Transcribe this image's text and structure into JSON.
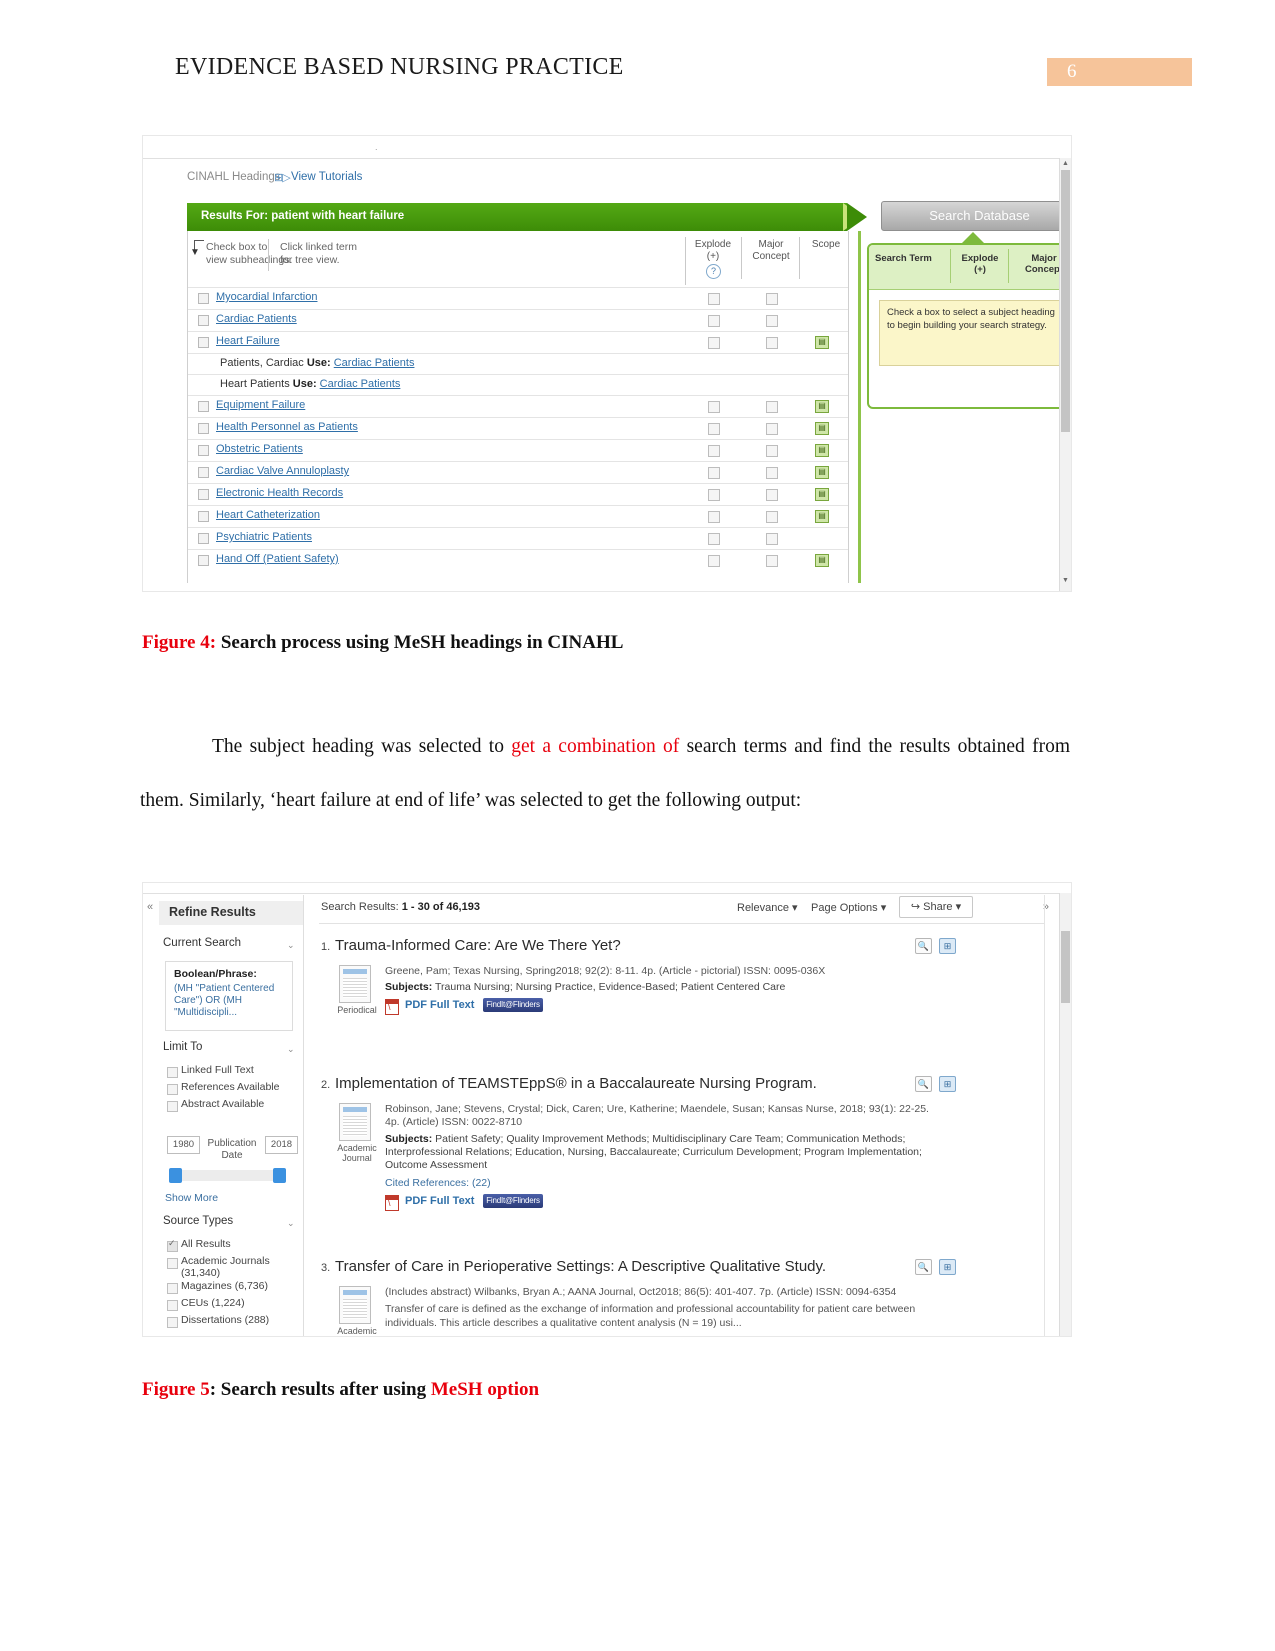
{
  "header": {
    "title": "EVIDENCE BASED NURSING PRACTICE",
    "page_number": "6",
    "accent_color": "#f6c49a"
  },
  "figure4": {
    "breadcrumb": "CINAHL Headings",
    "tutorials_link": "View Tutorials",
    "results_bar": "Results For: patient with heart failure",
    "hint_left": "Check box to\nview subheadings.",
    "hint_right": "Click linked term\nfor tree view.",
    "columns": {
      "explode": "Explode\n(+)",
      "major": "Major\nConcept",
      "scope": "Scope",
      "help": "?"
    },
    "rows": [
      {
        "term": "Myocardial Infarction",
        "type": "heading",
        "scope": false
      },
      {
        "term": "Cardiac Patients",
        "type": "heading",
        "scope": false
      },
      {
        "term": "Heart Failure",
        "type": "heading",
        "scope": true
      },
      {
        "type": "use",
        "prefix": "Patients, Cardiac ",
        "label": "Use:",
        "link": "Cardiac Patients"
      },
      {
        "type": "use",
        "prefix": "Heart Patients ",
        "label": "Use:",
        "link": "Cardiac Patients"
      },
      {
        "term": "Equipment Failure",
        "type": "heading",
        "scope": true
      },
      {
        "term": "Health Personnel as Patients",
        "type": "heading",
        "scope": true
      },
      {
        "term": "Obstetric Patients",
        "type": "heading",
        "scope": true
      },
      {
        "term": "Cardiac Valve Annuloplasty",
        "type": "heading",
        "scope": true
      },
      {
        "term": "Electronic Health Records",
        "type": "heading",
        "scope": true
      },
      {
        "term": "Heart Catheterization",
        "type": "heading",
        "scope": true
      },
      {
        "term": "Psychiatric Patients",
        "type": "heading",
        "scope": false
      },
      {
        "term": "Hand Off (Patient Safety)",
        "type": "heading",
        "scope": true
      }
    ],
    "search_database_button": "Search Database",
    "panel": {
      "col_term": "Search Term",
      "col_explode": "Explode\n(+)",
      "col_major": "Major\nConcept",
      "note": "Check a box to select a subject heading to begin building your search strategy."
    }
  },
  "caption4": {
    "label": "Figure 4:",
    "text": " Search process using MeSH headings in CINAHL"
  },
  "body": {
    "part1": "The subject heading was selected to ",
    "highlight1": "get a combination of",
    "part2": " search terms and find the results obtained from them. Similarly, ‘heart failure at end of life’ was selected to get the following output:"
  },
  "figure5": {
    "collapse_left_icon": "«",
    "collapse_right_icon": "»",
    "sidebar": {
      "title": "Refine Results",
      "current_search": "Current Search",
      "boolean_label": "Boolean/Phrase:",
      "boolean_value": "(MH \"Patient Centered Care\") OR (MH \"Multidiscipli...",
      "limit_to": "Limit To",
      "limits": [
        "Linked Full Text",
        "References Available",
        "Abstract Available"
      ],
      "year_from": "1980",
      "year_to": "2018",
      "pubdate_label": "Publication Date",
      "show_more": "Show More",
      "source_types": "Source Types",
      "sources": [
        {
          "label": "All Results",
          "checked": true
        },
        {
          "label": "Academic Journals (31,340)",
          "checked": false
        },
        {
          "label": "Magazines (6,736)",
          "checked": false
        },
        {
          "label": "CEUs (1,224)",
          "checked": false
        },
        {
          "label": "Dissertations (288)",
          "checked": false
        }
      ]
    },
    "toolbar": {
      "results_prefix": "Search Results: ",
      "results_range": "1 - 30 of 46,193",
      "relevance": "Relevance",
      "page_options": "Page Options",
      "share": "Share",
      "caret": "▾",
      "share_icon": "↪"
    },
    "results": [
      {
        "number": "1.",
        "title": "Trauma-Informed Care: Are We There Yet?",
        "meta": "Greene, Pam; Texas Nursing, Spring2018; 92(2): 8-11. 4p. (Article - pictorial) ISSN: 0095-036X",
        "subjects_label": "Subjects:",
        "subjects": " Trauma Nursing; Nursing Practice, Evidence-Based; Patient Centered Care",
        "thumb_label": "Periodical",
        "pdf_link": "PDF Full Text",
        "findit": "FindIt@Flinders"
      },
      {
        "number": "2.",
        "title": "Implementation of TEAMSTEppS® in a Baccalaureate Nursing Program.",
        "meta": "Robinson, Jane; Stevens, Crystal; Dick, Caren; Ure, Katherine; Maendele, Susan; Kansas Nurse, 2018; 93(1): 22-25. 4p. (Article) ISSN: 0022-8710",
        "subjects_label": "Subjects:",
        "subjects": " Patient Safety; Quality Improvement Methods; Multidisciplinary Care Team; Communication Methods; Interprofessional Relations; Education, Nursing, Baccalaureate; Curriculum Development; Program Implementation; Outcome Assessment",
        "thumb_label": "Academic Journal",
        "cited_references": "Cited References: (22)",
        "pdf_link": "PDF Full Text",
        "findit": "FindIt@Flinders"
      },
      {
        "number": "3.",
        "title": "Transfer of Care in Perioperative Settings: A Descriptive Qualitative Study.",
        "meta": "(Includes abstract) Wilbanks, Bryan A.; AANA Journal, Oct2018; 86(5): 401-407. 7p. (Article) ISSN: 0094-6354",
        "abstract": "Transfer of care is defined as the exchange of information and professional accountability for patient care between individuals. This article describes a qualitative content analysis (N = 19) usi...",
        "thumb_label": "Academic"
      }
    ]
  },
  "caption5": {
    "label": "Figure 5",
    "text": ": Search results after using ",
    "highlight": "MeSH option"
  }
}
